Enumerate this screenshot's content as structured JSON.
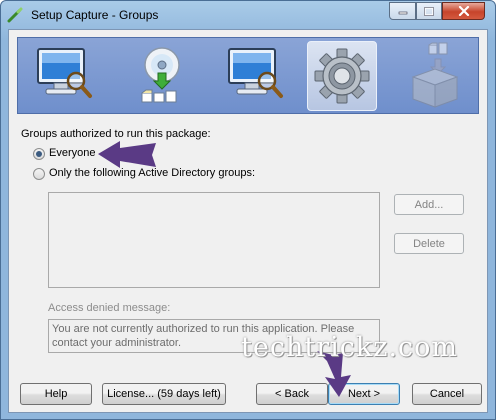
{
  "window": {
    "title": "Setup Capture - Groups"
  },
  "steps": [
    {
      "name": "monitor-scan-icon"
    },
    {
      "name": "disc-install-icon"
    },
    {
      "name": "monitor-scan-icon"
    },
    {
      "name": "gear-icon",
      "active": true
    },
    {
      "name": "package-box-icon"
    }
  ],
  "groups": {
    "heading": "Groups authorized to run this package:",
    "option_everyone": "Everyone",
    "option_ad_groups": "Only the following Active Directory groups:",
    "selected": "Everyone",
    "add_label": "Add...",
    "delete_label": "Delete"
  },
  "access_denied": {
    "label": "Access denied message:",
    "message": "You are not currently authorized to run this application. Please contact your administrator."
  },
  "footer": {
    "help_label": "Help",
    "license_label": "License... (59 days left)",
    "back_label": "< Back",
    "next_label": "Next >",
    "cancel_label": "Cancel"
  },
  "watermark": "techtrickz.com",
  "colors": {
    "annotation_arrow": "#5a3a85",
    "banner": "#7f9bd2"
  }
}
